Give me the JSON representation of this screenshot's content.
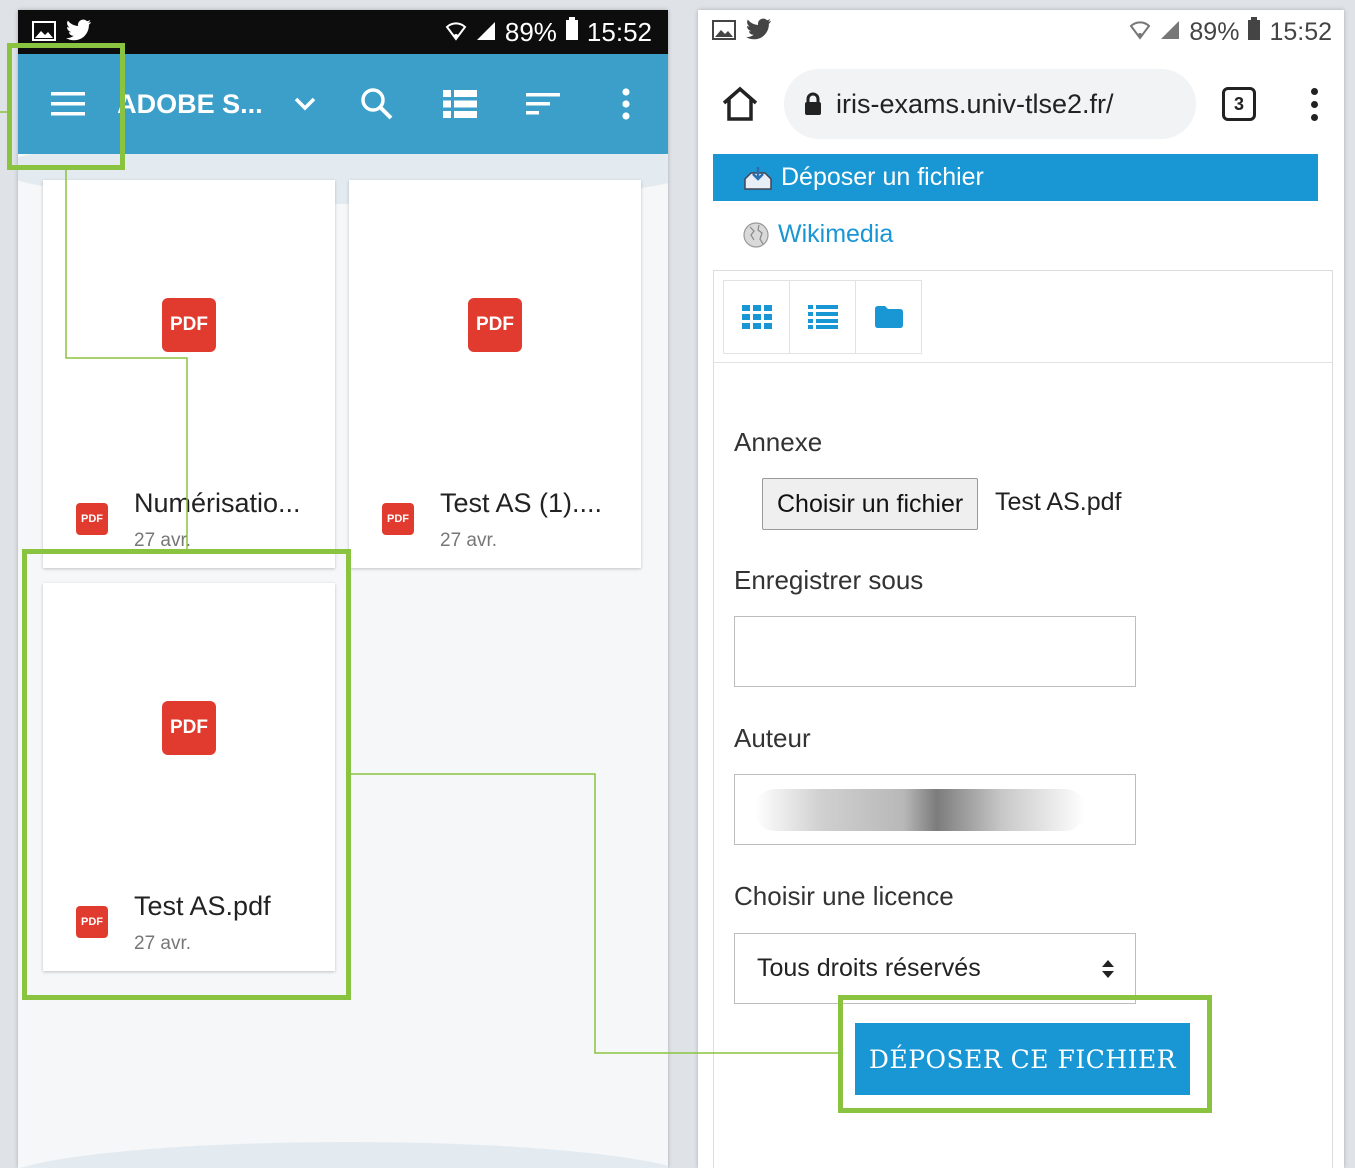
{
  "left_phone": {
    "status_bar": {
      "battery": "89%",
      "time": "15:52"
    },
    "app_bar": {
      "title": "ADOBE S..."
    },
    "files": [
      {
        "name": "Numérisatio...",
        "date": "27 avr.",
        "badge": "PDF"
      },
      {
        "name": "Test AS (1)....",
        "date": "27 avr.",
        "badge": "PDF"
      },
      {
        "name": "Test AS.pdf",
        "date": "27 avr.",
        "badge": "PDF"
      }
    ]
  },
  "right_phone": {
    "status_bar": {
      "battery": "89%",
      "time": "15:52"
    },
    "browser": {
      "url": "iris-exams.univ-tlse2.fr/",
      "tab_count": "3"
    },
    "repository_links": {
      "upload": "Déposer un fichier",
      "wikimedia": "Wikimedia"
    },
    "form": {
      "attachment_label": "Annexe",
      "choose_file_button": "Choisir un fichier",
      "chosen_file": "Test AS.pdf",
      "save_as_label": "Enregistrer sous",
      "save_as_value": "",
      "author_label": "Auteur",
      "license_label": "Choisir une licence",
      "license_value": "Tous droits réservés",
      "submit_button": "DÉPOSER CE FICHIER"
    }
  },
  "colors": {
    "app_bar": "#3b9fc9",
    "accent_blue": "#1996d4",
    "pdf_red": "#e03b2e",
    "highlight_green": "#8ac33f"
  }
}
